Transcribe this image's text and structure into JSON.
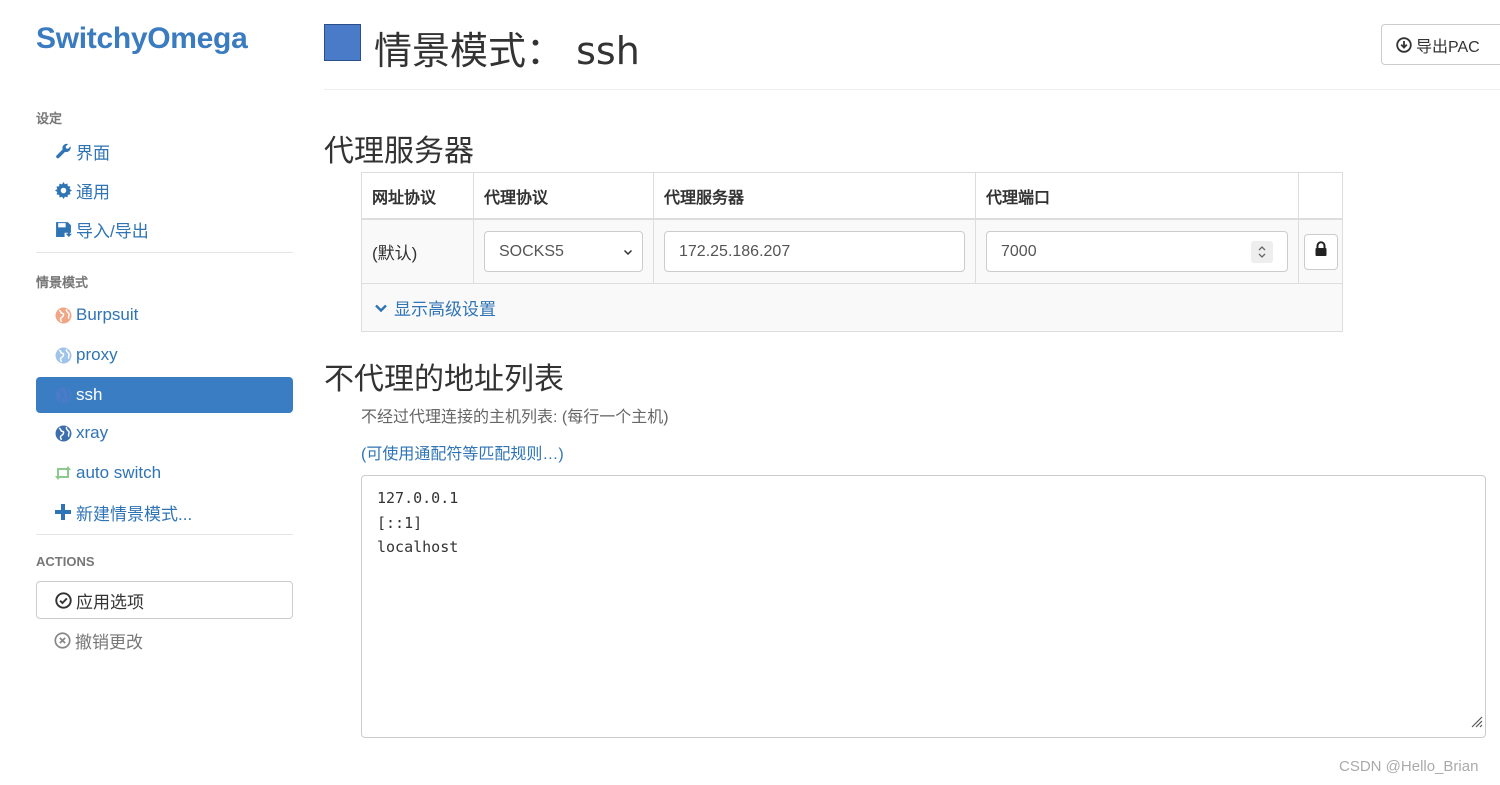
{
  "brand": "SwitchyOmega",
  "sidebar": {
    "settings_header": "设定",
    "settings_items": [
      {
        "label": "界面",
        "icon": "wrench-icon"
      },
      {
        "label": "通用",
        "icon": "gear-icon"
      },
      {
        "label": "导入/导出",
        "icon": "floppy-disk-icon"
      }
    ],
    "profiles_header": "情景模式",
    "profiles": [
      {
        "label": "Burpsuit",
        "icon": "globe-icon",
        "color": "#f0a585"
      },
      {
        "label": "proxy",
        "icon": "globe-icon",
        "color": "#9fc3ea"
      },
      {
        "label": "ssh",
        "icon": "globe-icon",
        "color": "#4a7bc8",
        "active": true
      },
      {
        "label": "xray",
        "icon": "globe-icon",
        "color": "#3d6fad"
      },
      {
        "label": "auto switch",
        "icon": "retweet-icon",
        "color": "#8cc98c"
      },
      {
        "label": "新建情景模式...",
        "icon": "plus-icon",
        "color": "#2f74b5"
      }
    ],
    "actions_header": "ACTIONS",
    "apply_label": "应用选项",
    "discard_label": "撤销更改"
  },
  "header": {
    "title_prefix": "情景模式：",
    "profile_name": "ssh",
    "profile_color": "#4a7bc8",
    "export_label": "导出PAC"
  },
  "proxy_section": {
    "title": "代理服务器",
    "columns": [
      "网址协议",
      "代理协议",
      "代理服务器",
      "代理端口"
    ],
    "row": {
      "scheme": "(默认)",
      "protocol": "SOCKS5",
      "server": "172.25.186.207",
      "port": "7000"
    },
    "advanced_label": "显示高级设置"
  },
  "bypass_section": {
    "title": "不代理的地址列表",
    "help_text": "不经过代理连接的主机列表: (每行一个主机)",
    "help_link": "(可使用通配符等匹配规则…)",
    "lines": [
      "127.0.0.1",
      "[::1]",
      "localhost"
    ]
  },
  "watermark": "CSDN @Hello_Brian"
}
